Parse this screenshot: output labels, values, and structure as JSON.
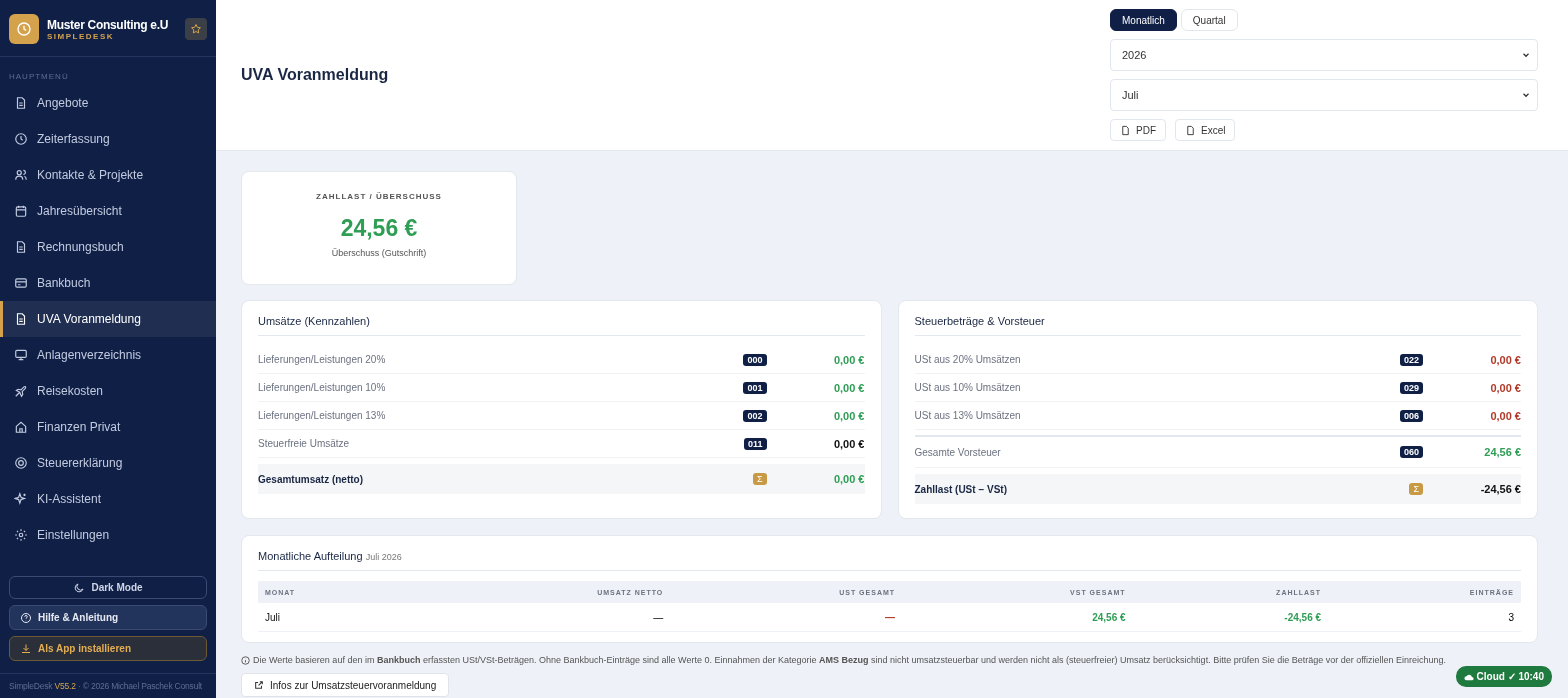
{
  "sidebar": {
    "company": "Muster Consulting e.U",
    "product": "SIMPLEDESK",
    "section": "HAUPTMENÜ",
    "items": [
      {
        "label": "Angebote",
        "selected": false
      },
      {
        "label": "Zeiterfassung",
        "selected": false
      },
      {
        "label": "Kontakte & Projekte",
        "selected": false
      },
      {
        "label": "Jahresübersicht",
        "selected": false
      },
      {
        "label": "Rechnungsbuch",
        "selected": false
      },
      {
        "label": "Bankbuch",
        "selected": false
      },
      {
        "label": "UVA Voranmeldung",
        "selected": true
      },
      {
        "label": "Anlagenverzeichnis",
        "selected": false
      },
      {
        "label": "Reisekosten",
        "selected": false
      },
      {
        "label": "Finanzen Privat",
        "selected": false
      },
      {
        "label": "Steuererklärung",
        "selected": false
      },
      {
        "label": "KI-Assistent",
        "selected": false
      },
      {
        "label": "Einstellungen",
        "selected": false
      }
    ],
    "buttons": [
      {
        "label": "Dark Mode",
        "kind": "dark"
      },
      {
        "label": "Hilfe & Anleitung",
        "kind": "help"
      },
      {
        "label": "Als App installieren",
        "kind": "install"
      }
    ],
    "footer_brand": "SimpleDesk",
    "footer_version": "V55.2",
    "footer_text": "· © 2026 Michael Paschek Consult"
  },
  "header": {
    "title": "UVA Voranmeldung",
    "period_tabs": [
      {
        "label": "Monatlich",
        "selected": true
      },
      {
        "label": "Quartal",
        "selected": false
      }
    ],
    "year": "2026",
    "month": "Juli",
    "exports": [
      "PDF",
      "Excel"
    ]
  },
  "summary": {
    "label": "ZAHLLAST / ÜBERSCHUSS",
    "value": "24,56 €",
    "caption": "Überschuss (Gutschrift)"
  },
  "cards": [
    {
      "title": "Umsätze (Kennzahlen)",
      "rows": [
        {
          "label": "Lieferungen/Leistungen 20%",
          "code": "000",
          "value": "0,00 €",
          "kind": "item",
          "color": "#2f9e55"
        },
        {
          "label": "Lieferungen/Leistungen 10%",
          "code": "001",
          "value": "0,00 €",
          "kind": "item",
          "color": "#2f9e55"
        },
        {
          "label": "Lieferungen/Leistungen 13%",
          "code": "002",
          "value": "0,00 €",
          "kind": "item",
          "color": "#2f9e55"
        },
        {
          "label": "Steuerfreie Umsätze",
          "code": "011",
          "value": "0,00 €",
          "kind": "item",
          "color": "#111111"
        },
        {
          "label": "Gesamtumsatz (netto)",
          "code": "Σ",
          "value": "0,00 €",
          "kind": "total",
          "color": "#2f9e55"
        }
      ]
    },
    {
      "title": "Steuerbeträge & Vorsteuer",
      "rows": [
        {
          "label": "USt aus 20% Umsätzen",
          "code": "022",
          "value": "0,00 €",
          "kind": "item",
          "color": "#b23a2a"
        },
        {
          "label": "USt aus 10% Umsätzen",
          "code": "029",
          "value": "0,00 €",
          "kind": "item",
          "color": "#b23a2a"
        },
        {
          "label": "USt aus 13% Umsätzen",
          "code": "006",
          "value": "0,00 €",
          "kind": "item",
          "color": "#b23a2a"
        },
        {
          "label": "Gesamte Vorsteuer",
          "code": "060",
          "value": "24,56 €",
          "kind": "subtotal",
          "color": "#2f9e55"
        },
        {
          "label": "Zahllast (USt − VSt)",
          "code": "Σ",
          "value": "-24,56 €",
          "kind": "total",
          "color": "#111111"
        }
      ]
    }
  ],
  "monthly": {
    "title": "Monatliche Aufteilung",
    "subtitle": "Juli 2026",
    "columns": [
      "MONAT",
      "UMSATZ NETTO",
      "UST GESAMT",
      "VST GESAMT",
      "ZAHLLAST",
      "EINTRÄGE"
    ],
    "rows": [
      {
        "cells": [
          {
            "text": "Juli"
          },
          {
            "text": "—"
          },
          {
            "text": "—",
            "color": "#b23a2a"
          },
          {
            "text": "24,56 €",
            "color": "#2f9e55"
          },
          {
            "text": "-24,56 €",
            "color": "#2f9e55"
          },
          {
            "text": "3"
          }
        ]
      }
    ]
  },
  "note": "Die Werte basieren auf den im **Bankbuch** erfassten USt/VSt-Beträgen. Ohne Bankbuch-Einträge sind alle Werte 0. Einnahmen der Kategorie **AMS Bezug** sind nicht umsatzsteuerbar und werden nicht als (steuerfreier) Umsatz berücksichtigt. Bitte prüfen Sie die Beträge vor der offiziellen Einreichung.",
  "info_link": "Infos zur Umsatzsteuervoranmeldung",
  "sync_badge": "Cloud ✓ 10:40"
}
